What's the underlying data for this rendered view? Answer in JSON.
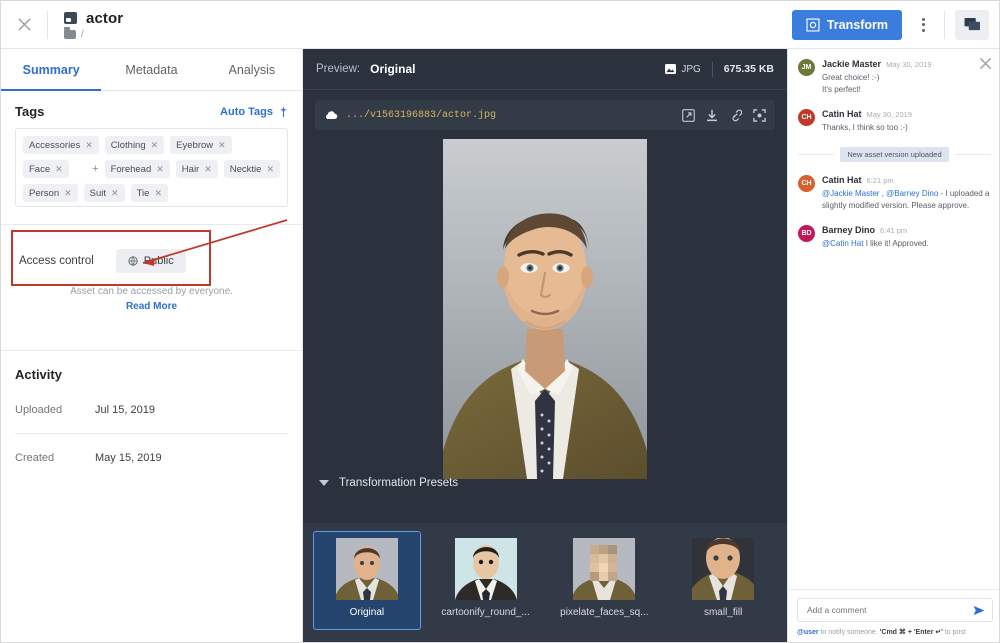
{
  "topbar": {
    "close_icon": "close-icon",
    "asset_icon": "image-icon",
    "asset_title": "actor",
    "folder_icon": "folder-icon",
    "breadcrumb": "/",
    "transform_label": "Transform",
    "transform_icon": "transform-icon",
    "more_icon": "kebab-menu-icon",
    "chat_icon": "comments-icon",
    "accent_color": "#3b7ddd"
  },
  "left": {
    "tabs": [
      {
        "label": "Summary",
        "active": true
      },
      {
        "label": "Metadata",
        "active": false
      },
      {
        "label": "Analysis",
        "active": false
      }
    ],
    "tags_section": {
      "title": "Tags",
      "auto_tags_label": "Auto Tags",
      "auto_tags_icon": "magic-wand-icon",
      "overflow": "+",
      "tags": [
        "Accessories",
        "Clothing",
        "Eyebrow",
        "Face",
        "Forehead",
        "Hair",
        "Necktie",
        "Person",
        "Suit",
        "Tie"
      ]
    },
    "access": {
      "label": "Access control",
      "value": "Public",
      "value_icon": "globe-icon",
      "note": "Asset can be accessed by everyone.",
      "note_link": "Read More"
    },
    "activity": {
      "title": "Activity",
      "rows": [
        {
          "key": "Uploaded",
          "value": "Jul 15, 2019"
        },
        {
          "key": "Created",
          "value": "May 15, 2019"
        }
      ]
    },
    "annotation_color": "#c0392b"
  },
  "preview": {
    "label": "Preview:",
    "value": "Original",
    "format_icon": "image-format-icon",
    "format": "JPG",
    "size": "675.35 KB",
    "url_icon": "cloud-icon",
    "url": ".../v1563196883/actor.jpg",
    "actions": [
      "open-external-icon",
      "download-icon",
      "copy-link-icon",
      "fullscreen-icon"
    ],
    "presets_title": "Transformation Presets",
    "presets_caret": "chevron-down-icon",
    "presets": [
      {
        "label": "Original",
        "selected": true
      },
      {
        "label": "cartoonify_round_...",
        "selected": false
      },
      {
        "label": "pixelate_faces_sq...",
        "selected": false
      },
      {
        "label": "small_fill",
        "selected": false
      }
    ]
  },
  "comments": {
    "close_icon": "close-icon",
    "items": [
      {
        "type": "comment",
        "initials": "JM",
        "color": "#6b7a3a",
        "name": "Jackie Master",
        "time": "May 30, 2019",
        "text": "Great choice! :-)\nIt's perfect!"
      },
      {
        "type": "comment",
        "initials": "CH",
        "color": "#c0392b",
        "name": "Catin Hat",
        "time": "May 30, 2019",
        "text": "Thanks, I think so too :-)"
      },
      {
        "type": "system",
        "text": "New asset version uploaded"
      },
      {
        "type": "comment",
        "initials": "CH",
        "color": "#d9602c",
        "name": "Catin Hat",
        "time": "6:21 pm",
        "mention": "@Jackie Master , @Barney Dino",
        "text": " - I uploaded a slightly modified version. Please approve."
      },
      {
        "type": "comment",
        "initials": "BD",
        "color": "#c2185b",
        "name": "Barney Dino",
        "time": "6:41 pm",
        "mention": "@Catin Hat",
        "text": " I like it! Approved."
      }
    ],
    "input_placeholder": "Add a comment",
    "send_icon": "send-icon",
    "hint_mention": "@user",
    "hint_rest": " to notify someone. ",
    "hint_keys": "'Cmd ⌘ + 'Enter ↵'",
    "hint_tail": " to post"
  }
}
